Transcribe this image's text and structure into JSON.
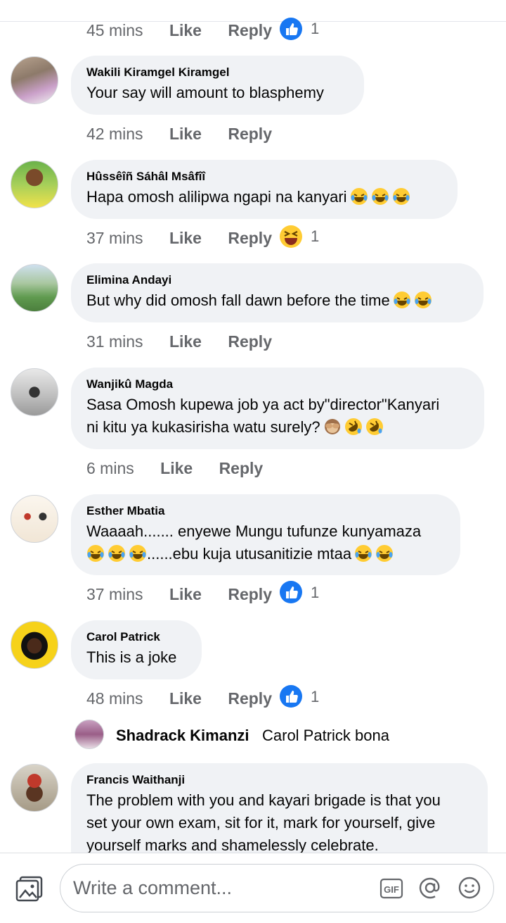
{
  "top": {
    "time": "45 mins",
    "like_label": "Like",
    "reply_label": "Reply",
    "reaction_count": "1"
  },
  "comments": [
    {
      "name": "Wakili Kiramgel Kiramgel",
      "lines": [
        "Your say will amount to blasphemy"
      ],
      "time": "42 mins",
      "like_label": "Like",
      "reply_label": "Reply"
    },
    {
      "name": "Hûssêîñ Sáhâl Msâfîî",
      "lines": [
        "Hapa omosh alilipwa ngapi na kanyari"
      ],
      "time": "37 mins",
      "like_label": "Like",
      "reply_label": "Reply",
      "reaction": "laughing-squint-icon",
      "reaction_count": "1"
    },
    {
      "name": "Elimina Andayi",
      "lines": [
        "But why did omosh fall dawn before the time"
      ],
      "time": "31 mins",
      "like_label": "Like",
      "reply_label": "Reply"
    },
    {
      "name": "Wanjikû Magda",
      "lines": [
        "Sasa Omosh kupewa job ya act by\"director\"Kanyari",
        "ni kitu ya kukasirisha watu surely?"
      ],
      "time": "6 mins",
      "like_label": "Like",
      "reply_label": "Reply"
    },
    {
      "name": "Esther Mbatia",
      "lines": [
        "Waaaah....... enyewe Mungu tufunze kunyamaza",
        "......ebu kuja utusanitizie mtaa"
      ],
      "time": "37 mins",
      "like_label": "Like",
      "reply_label": "Reply",
      "reaction": "like-icon",
      "reaction_count": "1"
    },
    {
      "name": "Carol Patrick",
      "lines": [
        "This is a joke"
      ],
      "time": "48 mins",
      "like_label": "Like",
      "reply_label": "Reply",
      "reaction": "like-icon",
      "reaction_count": "1"
    },
    {
      "name": "Francis Waithanji",
      "lines": [
        "The problem with you and kayari brigade is that you",
        "set your own exam, sit for it, mark for yourself, give",
        "yourself marks and shamelessly celebrate."
      ]
    }
  ],
  "reply": {
    "name": "Shadrack Kimanzi",
    "text": "Carol Patrick bona"
  },
  "composer": {
    "placeholder": "Write a comment...",
    "gif_label": "GIF"
  },
  "colors": {
    "bubble": "#f0f2f5",
    "meta": "#65676b",
    "like_blue": "#1877f2"
  }
}
